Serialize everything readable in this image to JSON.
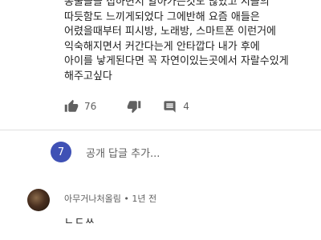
{
  "comment": {
    "lines": [
      "동물들을 접하면서 알아가는것도 많았고 시골의",
      "따듯함도 느끼게되었다 그에반해 요즘 애들은",
      "어렸을때부터 피시방, 노래방, 스마트폰 이런거에",
      "익숙해지면서 커간다는게 안타깝다 내가 후에",
      "아이를 낳게된다면 꼭 자연이있는곳에서 자랄수있게",
      "해주고싶다"
    ],
    "like_count": "76",
    "reply_count": "4"
  },
  "reply_box": {
    "avatar_letter": "7",
    "avatar_color": "#3f51b5",
    "placeholder": "공개 답글 추가..."
  },
  "reply": {
    "author": "아무거나처올림",
    "time": "1년 전",
    "text": "ㄴㄷㅆ"
  },
  "icons": {
    "like": "thumbs-up-icon",
    "dislike": "thumbs-down-icon",
    "replies": "comment-icon"
  }
}
